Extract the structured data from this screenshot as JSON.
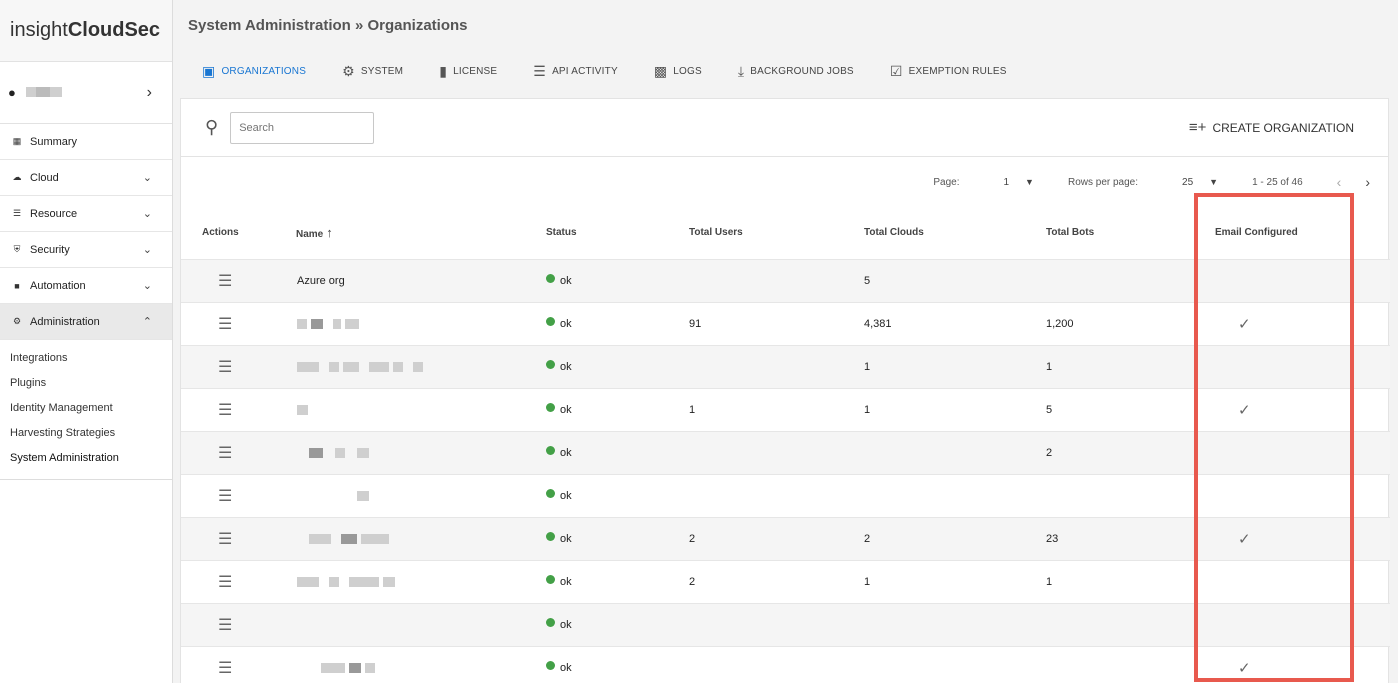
{
  "app": {
    "logo_light": "insight",
    "logo_bold": "CloudSec"
  },
  "sidebar": {
    "items": [
      {
        "label": "Summary",
        "icon": "grid-icon"
      },
      {
        "label": "Cloud",
        "icon": "cloud-icon"
      },
      {
        "label": "Resource",
        "icon": "list-icon"
      },
      {
        "label": "Security",
        "icon": "shield-icon"
      },
      {
        "label": "Automation",
        "icon": "lock-icon"
      },
      {
        "label": "Administration",
        "icon": "gear-icon"
      }
    ],
    "subitems": [
      "Integrations",
      "Plugins",
      "Identity Management",
      "Harvesting Strategies",
      "System Administration"
    ]
  },
  "header": {
    "breadcrumb": "System Administration » Organizations"
  },
  "tabs": [
    "ORGANIZATIONS",
    "SYSTEM",
    "LICENSE",
    "API ACTIVITY",
    "LOGS",
    "BACKGROUND JOBS",
    "EXEMPTION RULES"
  ],
  "toolbar": {
    "search_placeholder": "Search",
    "create_label": "CREATE ORGANIZATION"
  },
  "pager": {
    "page_label": "Page:",
    "page_value": "1",
    "rows_label": "Rows per page:",
    "rows_value": "25",
    "range": "1 - 25 of 46"
  },
  "table": {
    "columns": [
      "Actions",
      "Name",
      "Status",
      "Total Users",
      "Total Clouds",
      "Total Bots",
      "Email Configured"
    ],
    "rows": [
      {
        "name": "Azure org",
        "status": "ok",
        "users": "",
        "clouds": "5",
        "bots": "",
        "email": false
      },
      {
        "name": "",
        "status": "ok",
        "users": "91",
        "clouds": "4,381",
        "bots": "1,200",
        "email": true
      },
      {
        "name": "",
        "status": "ok",
        "users": "",
        "clouds": "1",
        "bots": "1",
        "email": false
      },
      {
        "name": "",
        "status": "ok",
        "users": "1",
        "clouds": "1",
        "bots": "5",
        "email": true
      },
      {
        "name": "",
        "status": "ok",
        "users": "",
        "clouds": "",
        "bots": "2",
        "email": false
      },
      {
        "name": "",
        "status": "ok",
        "users": "",
        "clouds": "",
        "bots": "",
        "email": false
      },
      {
        "name": "",
        "status": "ok",
        "users": "2",
        "clouds": "2",
        "bots": "23",
        "email": true
      },
      {
        "name": "",
        "status": "ok",
        "users": "2",
        "clouds": "1",
        "bots": "1",
        "email": false
      },
      {
        "name": "",
        "status": "ok",
        "users": "",
        "clouds": "",
        "bots": "",
        "email": false
      },
      {
        "name": "",
        "status": "ok",
        "users": "",
        "clouds": "",
        "bots": "",
        "email": true
      }
    ]
  },
  "colors": {
    "accent": "#1976d2",
    "status_ok": "#43a047",
    "highlight": "#e8594e"
  }
}
